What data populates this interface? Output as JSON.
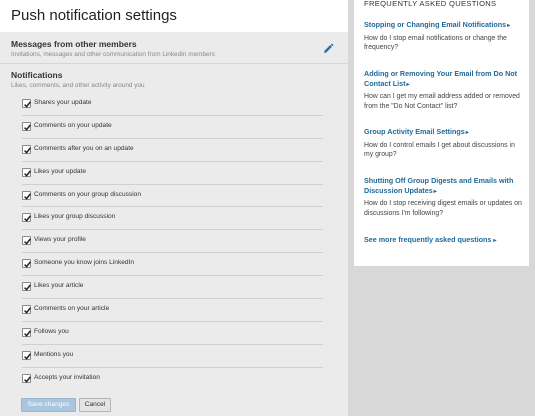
{
  "page": {
    "title": "Push notification settings"
  },
  "messages_section": {
    "title": "Messages from other members",
    "subtitle": "Invitations, messages and other communication from LinkedIn members",
    "edit_icon": "pencil-icon"
  },
  "notifications_section": {
    "title": "Notifications",
    "subtitle": "Likes, comments, and other activity around you",
    "items": [
      {
        "label": "Shares your update",
        "checked": true
      },
      {
        "label": "Comments on your update",
        "checked": true
      },
      {
        "label": "Comments after you on an update",
        "checked": true
      },
      {
        "label": "Likes your update",
        "checked": true
      },
      {
        "label": "Comments on your group discussion",
        "checked": true
      },
      {
        "label": "Likes your group discussion",
        "checked": true
      },
      {
        "label": "Views your profile",
        "checked": true
      },
      {
        "label": "Someone you know joins LinkedIn",
        "checked": true
      },
      {
        "label": "Likes your article",
        "checked": true
      },
      {
        "label": "Comments on your article",
        "checked": true
      },
      {
        "label": "Follows you",
        "checked": true
      },
      {
        "label": "Mentions you",
        "checked": true
      },
      {
        "label": "Accepts your invitation",
        "checked": true
      }
    ]
  },
  "actions": {
    "save_label": "Save changes",
    "cancel_label": "Cancel"
  },
  "faq": {
    "header": "FREQUENTLY ASKED QUESTIONS",
    "entries": [
      {
        "link": "Stopping or Changing Email Notifications",
        "desc": "How do I stop email notifications or change the frequency?"
      },
      {
        "link": "Adding or Removing Your Email from Do Not Contact List",
        "desc": "How can I get my email address added or removed from the \"Do Not Contact\" list?"
      },
      {
        "link": "Group Activity Email Settings",
        "desc": "How do I control emails I get about discussions in my group?"
      },
      {
        "link": "Shutting Off Group Digests and Emails with Discussion Updates",
        "desc": "How do I stop receiving digest emails or updates on discussions I'm following?"
      }
    ],
    "more_link": "See more frequently asked questions"
  },
  "colors": {
    "link": "#1f6a9a",
    "save_button": "#a9c6de",
    "panel_bg": "#ebebeb"
  }
}
